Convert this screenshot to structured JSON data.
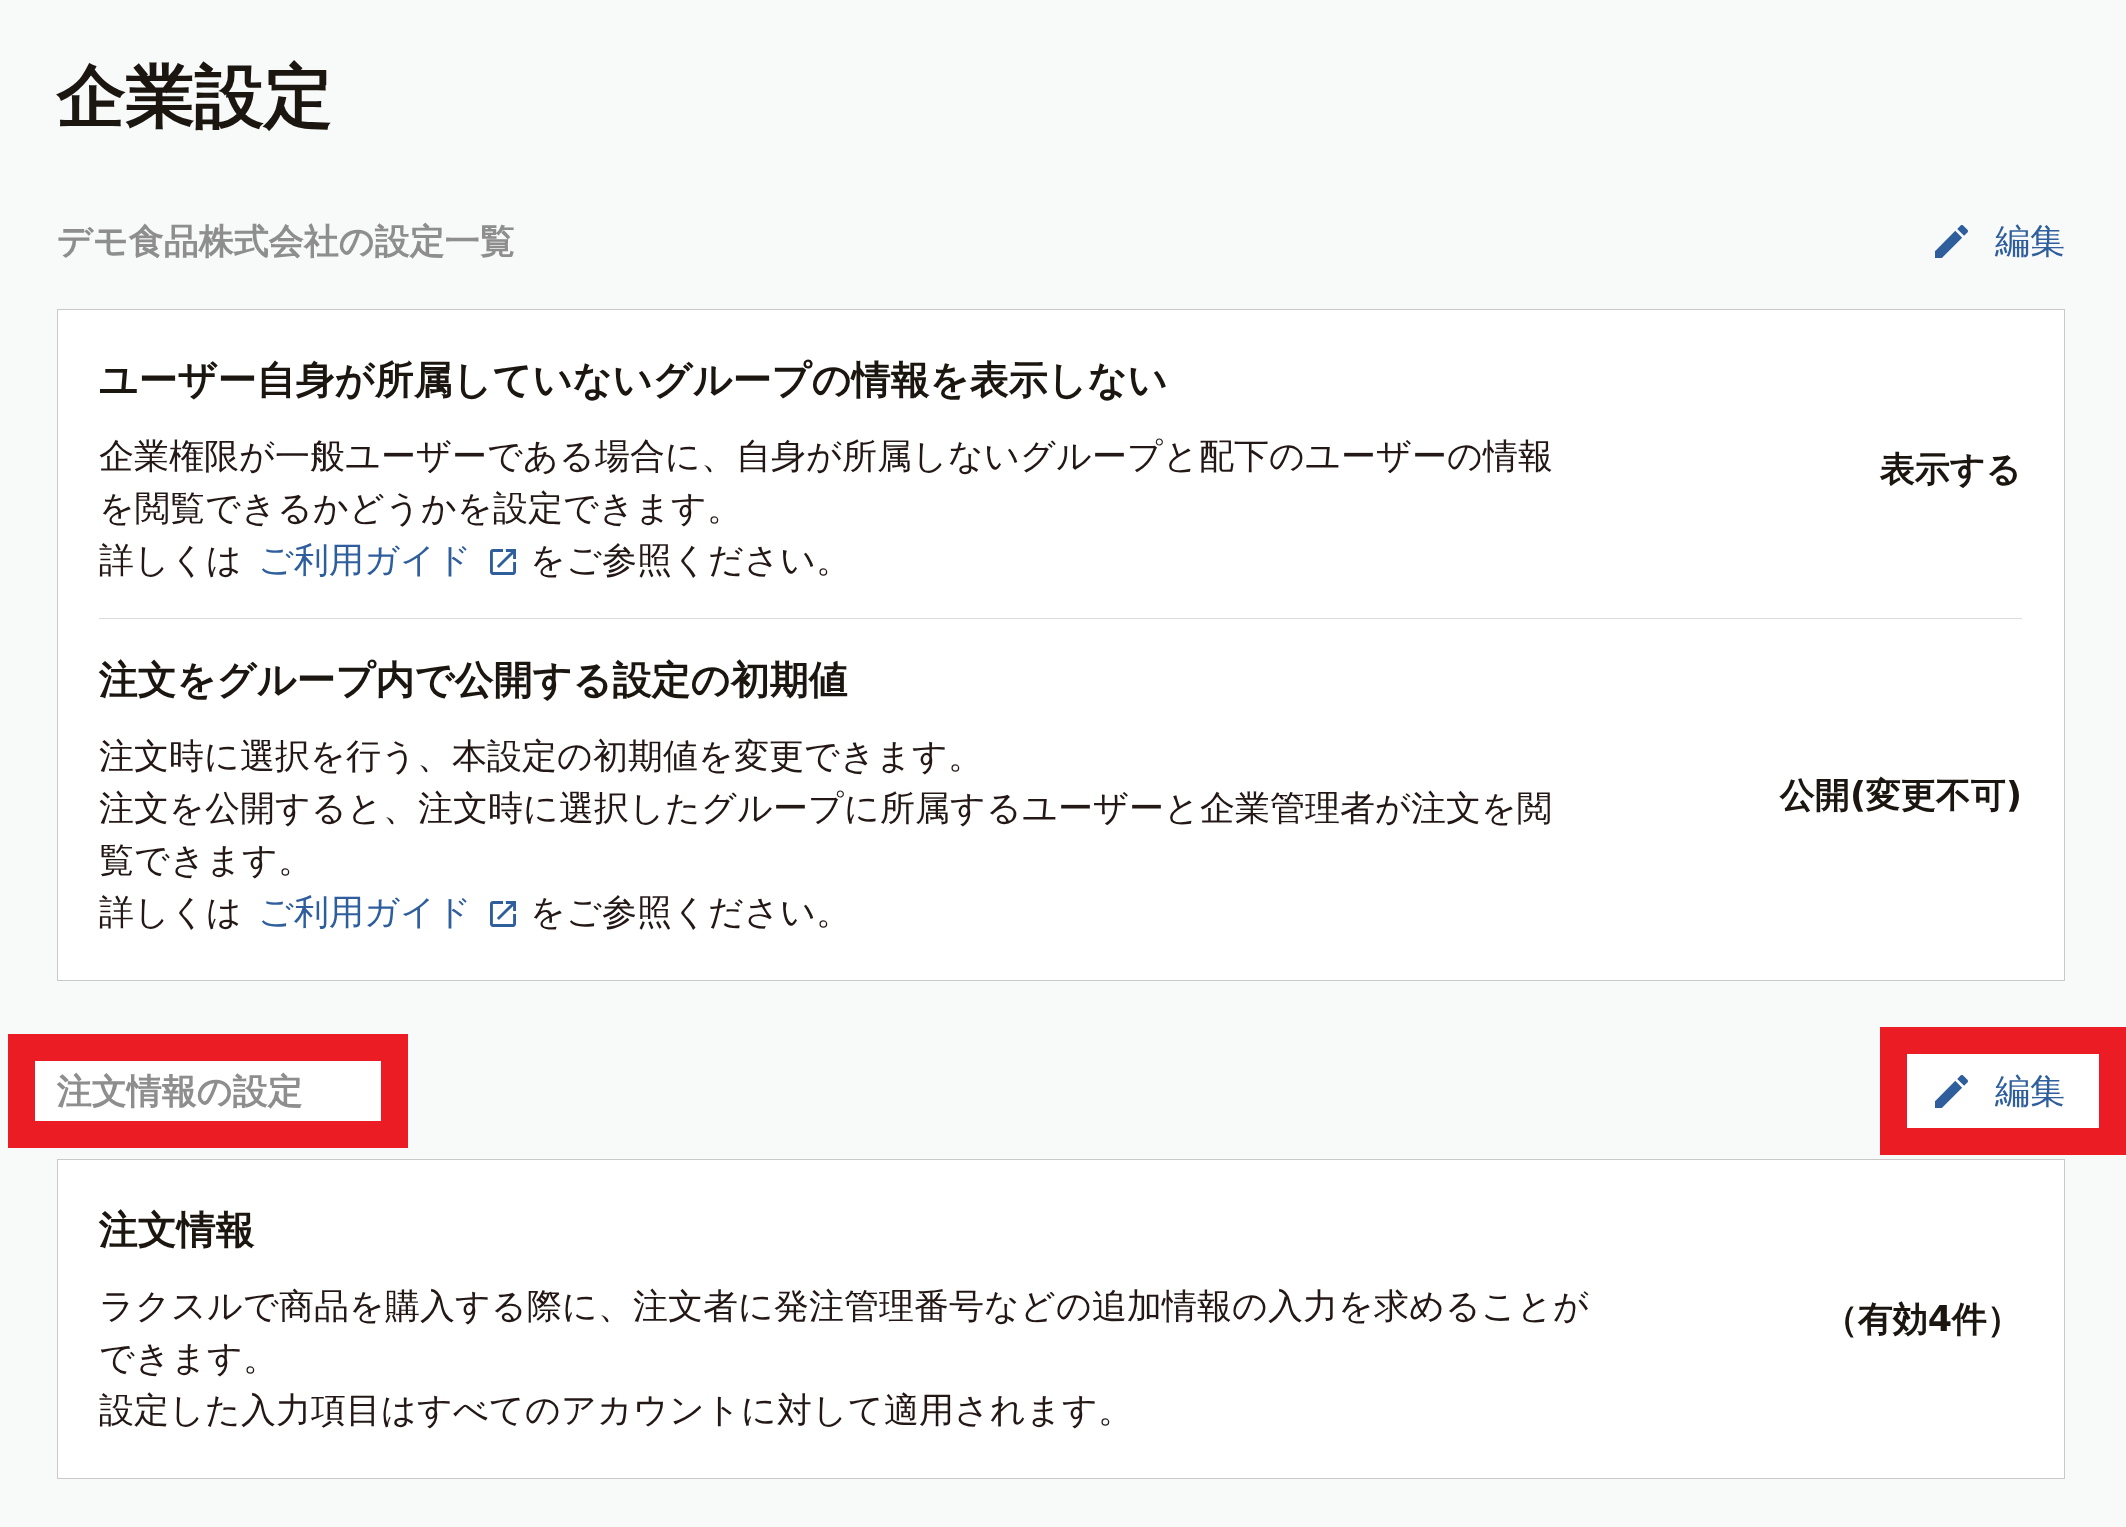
{
  "page": {
    "title": "企業設定"
  },
  "sections": [
    {
      "heading": "デモ食品株式会社の設定一覧",
      "heading_highlighted": false,
      "edit_button": {
        "label": "編集",
        "highlighted": false
      },
      "settings": [
        {
          "title": "ユーザー自身が所属していないグループの情報を表示しない",
          "description": [
            "企業権限が一般ユーザーである場合に、自身が所属しないグループと配下のユーザーの情報を閲覧できるかどうかを設定できます。"
          ],
          "guide": {
            "lead": "詳しくは",
            "link": "ご利用ガイド",
            "tail": "をご参照ください。"
          },
          "value": "表示する"
        },
        {
          "title": "注文をグループ内で公開する設定の初期値",
          "description": [
            "注文時に選択を行う、本設定の初期値を変更できます。",
            "注文を公開すると、注文時に選択したグループに所属するユーザーと企業管理者が注文を閲覧できます。"
          ],
          "guide": {
            "lead": "詳しくは",
            "link": "ご利用ガイド",
            "tail": "をご参照ください。"
          },
          "value": "公開(変更不可)"
        }
      ]
    },
    {
      "heading": "注文情報の設定",
      "heading_highlighted": true,
      "edit_button": {
        "label": "編集",
        "highlighted": true
      },
      "settings": [
        {
          "title": "注文情報",
          "description": [
            "ラクスルで商品を購入する際に、注文者に発注管理番号などの追加情報の入力を求めることができます。",
            "設定した入力項目はすべてのアカウントに対して適用されます。"
          ],
          "value": "（有効4件）"
        }
      ]
    }
  ]
}
